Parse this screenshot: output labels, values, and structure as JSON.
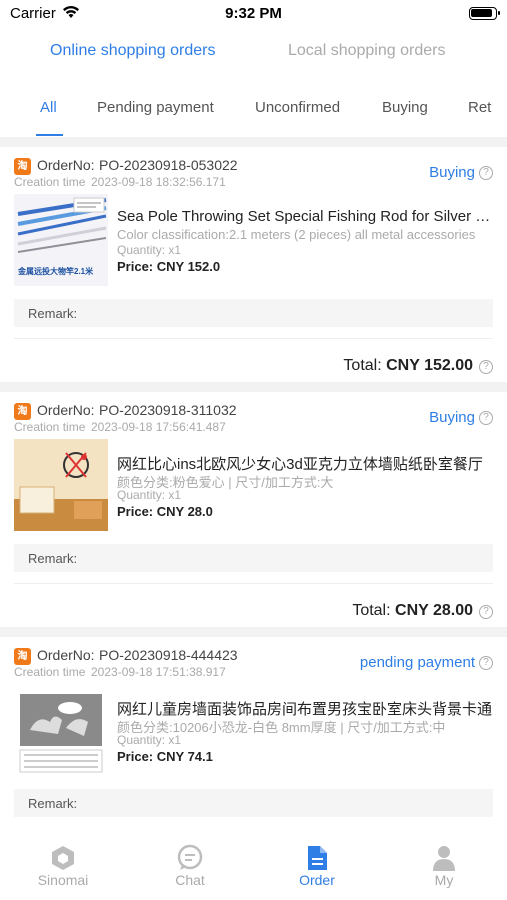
{
  "status_bar": {
    "carrier": "Carrier",
    "time": "9:32 PM"
  },
  "top_tabs": {
    "online": "Online shopping orders",
    "local": "Local shopping orders"
  },
  "status_tabs": [
    "All",
    "Pending payment",
    "Unconfirmed",
    "Buying",
    "Ret"
  ],
  "labels": {
    "order_no": "OrderNo:",
    "creation_time": "Creation time",
    "remark": "Remark:",
    "total": "Total:"
  },
  "orders": [
    {
      "order_no": "PO-20230918-053022",
      "creation_time": "2023-09-18 18:32:56.171",
      "status": "Buying",
      "title": "Sea Pole Throwing Set Special Fishing Rod for Silver Carp",
      "spec": "Color classification:2.1 meters (2 pieces) all metal accessories",
      "quantity": "Quantity: x1",
      "price": "Price: CNY 152.0",
      "total": "CNY 152.00",
      "image_caption": "金属远投大物竿2.1米"
    },
    {
      "order_no": "PO-20230918-311032",
      "creation_time": "2023-09-18 17:56:41.487",
      "status": "Buying",
      "title": "网红比心ins北欧风少女心3d亚克力立体墙贴纸卧室餐厅",
      "spec": "颜色分类:粉色爱心 | 尺寸/加工方式:大",
      "quantity": "Quantity: x1",
      "price": "Price: CNY 28.0",
      "total": "CNY 28.00"
    },
    {
      "order_no": "PO-20230918-444423",
      "creation_time": "2023-09-18 17:51:38.917",
      "status": "pending payment",
      "title": "网红儿童房墙面装饰品房间布置男孩宝卧室床头背景卡通",
      "spec": "颜色分类:10206小恐龙-白色 8mm厚度 | 尺寸/加工方式:中",
      "quantity": "Quantity: x1",
      "price": "Price: CNY 74.1"
    }
  ],
  "bottom_nav": [
    "Sinomai",
    "Chat",
    "Order",
    "My"
  ],
  "colors": {
    "accent": "#2f7ee6",
    "shop_icon": "#f07a1a"
  }
}
